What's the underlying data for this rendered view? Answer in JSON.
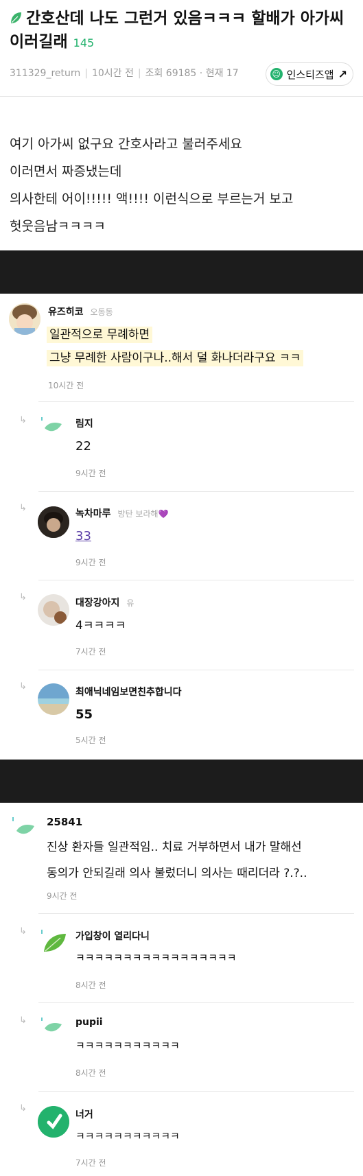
{
  "post": {
    "title": "간호산데 나도 그런거 있음ㅋㅋㅋ 할배가 아가씨 이러길래",
    "comment_count": "145",
    "author": "311329_return",
    "time": "10시간 전",
    "views": "조회 69185 · 현재 17",
    "app_button": "인스티즈앱",
    "body": [
      "여기 아가씨 없구요 간호사라고 불러주세요",
      "이러면서 짜증냈는데",
      "의사한테 어이!!!!! 액!!!! 이런식으로 부르는거 보고",
      "헛웃음남ㅋㅋㅋㅋ"
    ]
  },
  "comments1": {
    "top": {
      "nick": "유즈히코",
      "tag": "오동동",
      "lines": [
        "일관적으로 무례하면",
        "그냥 무례한 사람이구나..해서 덜 화나더라구요 ㅋㅋ"
      ],
      "time": "10시간 전"
    },
    "replies": [
      {
        "nick": "림지",
        "tag": "",
        "text": "22",
        "time": "9시간 전"
      },
      {
        "nick": "녹차마루",
        "tag": "방탄 보라해💜",
        "text": "33",
        "time": "9시간 전"
      },
      {
        "nick": "대장강아지",
        "tag": "유",
        "text": "4ㅋㅋㅋㅋ",
        "time": "7시간 전"
      },
      {
        "nick": "최애닉네임보면친추합니다",
        "tag": "",
        "text": "55",
        "time": "5시간 전"
      }
    ]
  },
  "comments2": {
    "top": {
      "nick": "25841",
      "lines": [
        "진상 환자들 일관적임.. 치료 거부하면서 내가 말해선",
        "동의가 안되길래 의사 불렀더니 의사는 때리더라 ?.?.."
      ],
      "time": "9시간 전"
    },
    "replies": [
      {
        "nick": "가입창이 열리다니",
        "text": "ㅋㅋㅋㅋㅋㅋㅋㅋㅋㅋㅋㅋㅋㅋㅋㅋㅋ",
        "time": "8시간 전"
      },
      {
        "nick": "pupii",
        "text": "ㅋㅋㅋㅋㅋㅋㅋㅋㅋㅋㅋ",
        "time": "8시간 전"
      },
      {
        "nick": "너거",
        "text": "ㅋㅋㅋㅋㅋㅋㅋㅋㅋㅋㅋ",
        "time": "7시간 전"
      }
    ]
  },
  "reply_arrow": "↳",
  "colors": {
    "accent": "#23b26d",
    "highlight": "#fff8d6",
    "black_bar": "#1c1c1c",
    "link": "#5b3fa8"
  }
}
